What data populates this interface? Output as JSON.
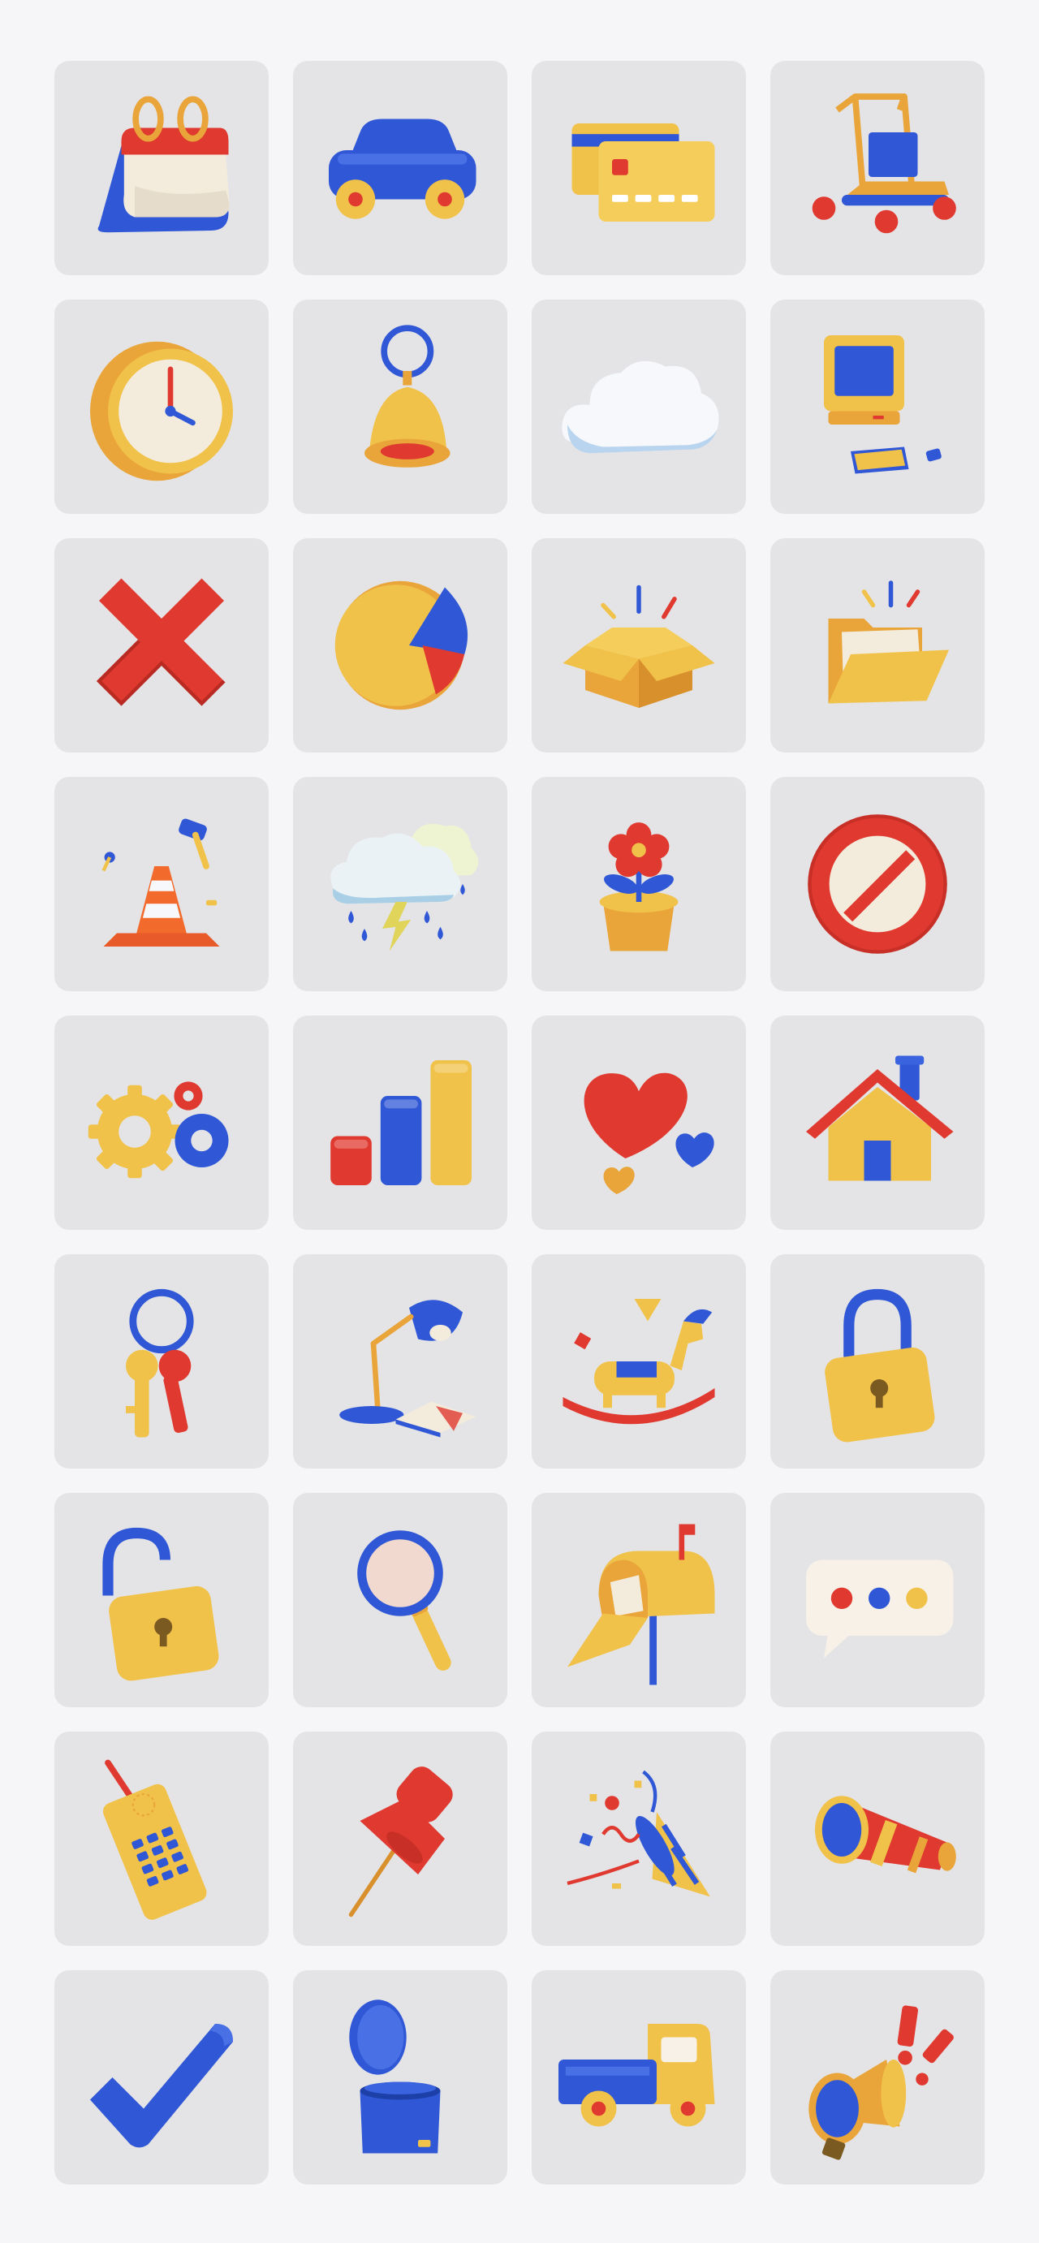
{
  "palette": {
    "background": "#f6f6f8",
    "tile": "#e4e4e6",
    "red": "#e0392f",
    "blue": "#2f57d6",
    "yellow": "#f1c24a",
    "orange": "#e9a53a",
    "cream": "#f3ebdc",
    "white": "#f7f8fb"
  },
  "icons": [
    "calendar-icon",
    "toy-car-icon",
    "credit-cards-icon",
    "shopping-cart-icon",
    "clock-icon",
    "bell-icon",
    "cloud-icon",
    "retro-computer-icon",
    "close-x-icon",
    "pie-chart-icon",
    "open-box-icon",
    "open-folder-icon",
    "traffic-cone-tools-icon",
    "storm-cloud-icon",
    "potted-flower-icon",
    "prohibited-sign-icon",
    "gears-icon",
    "bar-chart-icon",
    "hearts-icon",
    "house-icon",
    "keys-icon",
    "desk-lamp-icon",
    "rocking-horse-icon",
    "padlock-closed-icon",
    "padlock-open-icon",
    "magnifying-glass-icon",
    "mailbox-icon",
    "chat-bubble-icon",
    "mobile-phone-icon",
    "push-pin-icon",
    "party-popper-icon",
    "telescope-icon",
    "checkmark-icon",
    "trash-bin-icon",
    "pickup-truck-icon",
    "megaphone-icon"
  ]
}
